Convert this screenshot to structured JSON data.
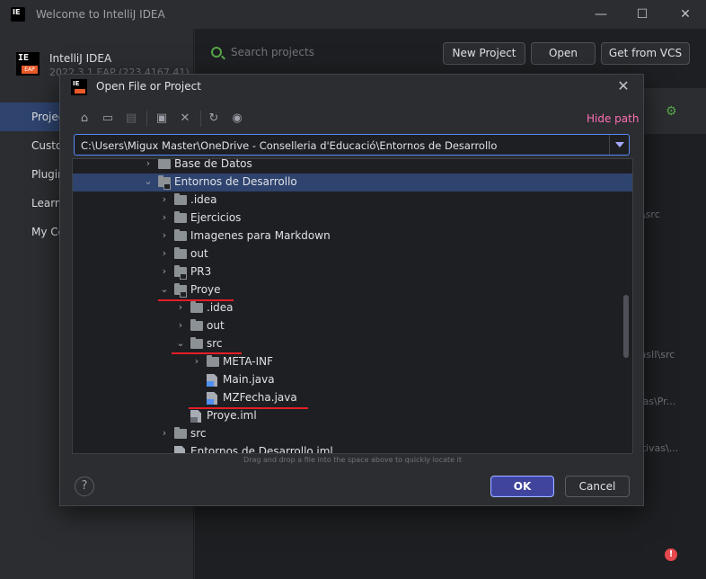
{
  "window": {
    "title": "Welcome to IntelliJ IDEA",
    "controls": [
      "—",
      "☐",
      "✕"
    ]
  },
  "sidebar": {
    "product_name": "IntelliJ IDEA",
    "product_version": "2022.3.1 EAP (223.4167.41)",
    "logo_text": "IE",
    "logo_badge": "EAP",
    "items": [
      {
        "label": "Projects",
        "active": true
      },
      {
        "label": "Customize"
      },
      {
        "label": "Plugins"
      },
      {
        "label": "Learn"
      },
      {
        "label": "My Co"
      }
    ]
  },
  "main": {
    "search_placeholder": "Search projects",
    "buttons": {
      "new_project": "New Project",
      "open": "Open",
      "vcs": "Get from VCS"
    },
    "bg_paths": [
      "\\src",
      "ivasII\\src",
      "ivas\\Pr...",
      "nativas\\..."
    ]
  },
  "dialog": {
    "title": "Open File or Project",
    "hide_path": "Hide path",
    "path": "C:\\Users\\Migux Master\\OneDrive - Conselleria d'Educació\\Entornos de Desarrollo",
    "hint": "Drag and drop a file into the space above to quickly locate it",
    "ok": "OK",
    "cancel": "Cancel",
    "help": "?",
    "tree": [
      {
        "label": "Base de Datos",
        "level": 0,
        "type": "folder",
        "chevron": "right"
      },
      {
        "label": "Entornos de Desarrollo",
        "level": 0,
        "type": "folder-mod",
        "chevron": "down",
        "selected": true
      },
      {
        "label": ".idea",
        "level": 1,
        "type": "folder",
        "chevron": "right"
      },
      {
        "label": "Ejercicios",
        "level": 1,
        "type": "folder",
        "chevron": "right"
      },
      {
        "label": "Imagenes para Markdown",
        "level": 1,
        "type": "folder",
        "chevron": "right"
      },
      {
        "label": "out",
        "level": 1,
        "type": "folder",
        "chevron": "right"
      },
      {
        "label": "PR3",
        "level": 1,
        "type": "folder-mod",
        "chevron": "right"
      },
      {
        "label": "Proye",
        "level": 1,
        "type": "folder-mod",
        "chevron": "down"
      },
      {
        "label": ".idea",
        "level": 2,
        "type": "folder",
        "chevron": "right"
      },
      {
        "label": "out",
        "level": 2,
        "type": "folder",
        "chevron": "right"
      },
      {
        "label": "src",
        "level": 2,
        "type": "folder",
        "chevron": "down"
      },
      {
        "label": "META-INF",
        "level": 3,
        "type": "folder",
        "chevron": "right"
      },
      {
        "label": "Main.java",
        "level": 3,
        "type": "java",
        "chevron": ""
      },
      {
        "label": "MZFecha.java",
        "level": 3,
        "type": "java",
        "chevron": ""
      },
      {
        "label": "Proye.iml",
        "level": 2,
        "type": "iml",
        "chevron": ""
      },
      {
        "label": "src",
        "level": 1,
        "type": "folder",
        "chevron": "right"
      },
      {
        "label": "Entornos de Desarrollo.iml",
        "level": 1,
        "type": "iml",
        "chevron": ""
      }
    ]
  }
}
